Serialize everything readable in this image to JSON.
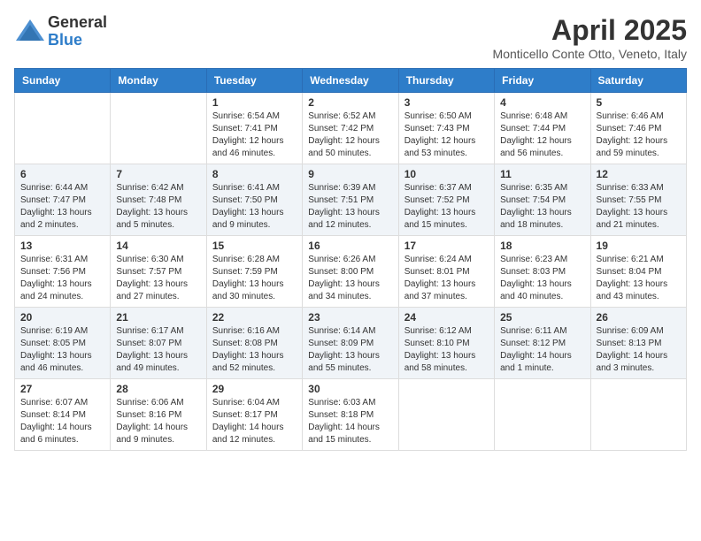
{
  "header": {
    "logo_general": "General",
    "logo_blue": "Blue",
    "month": "April 2025",
    "location": "Monticello Conte Otto, Veneto, Italy"
  },
  "weekdays": [
    "Sunday",
    "Monday",
    "Tuesday",
    "Wednesday",
    "Thursday",
    "Friday",
    "Saturday"
  ],
  "weeks": [
    [
      {
        "day": "",
        "info": ""
      },
      {
        "day": "",
        "info": ""
      },
      {
        "day": "1",
        "info": "Sunrise: 6:54 AM\nSunset: 7:41 PM\nDaylight: 12 hours and 46 minutes."
      },
      {
        "day": "2",
        "info": "Sunrise: 6:52 AM\nSunset: 7:42 PM\nDaylight: 12 hours and 50 minutes."
      },
      {
        "day": "3",
        "info": "Sunrise: 6:50 AM\nSunset: 7:43 PM\nDaylight: 12 hours and 53 minutes."
      },
      {
        "day": "4",
        "info": "Sunrise: 6:48 AM\nSunset: 7:44 PM\nDaylight: 12 hours and 56 minutes."
      },
      {
        "day": "5",
        "info": "Sunrise: 6:46 AM\nSunset: 7:46 PM\nDaylight: 12 hours and 59 minutes."
      }
    ],
    [
      {
        "day": "6",
        "info": "Sunrise: 6:44 AM\nSunset: 7:47 PM\nDaylight: 13 hours and 2 minutes."
      },
      {
        "day": "7",
        "info": "Sunrise: 6:42 AM\nSunset: 7:48 PM\nDaylight: 13 hours and 5 minutes."
      },
      {
        "day": "8",
        "info": "Sunrise: 6:41 AM\nSunset: 7:50 PM\nDaylight: 13 hours and 9 minutes."
      },
      {
        "day": "9",
        "info": "Sunrise: 6:39 AM\nSunset: 7:51 PM\nDaylight: 13 hours and 12 minutes."
      },
      {
        "day": "10",
        "info": "Sunrise: 6:37 AM\nSunset: 7:52 PM\nDaylight: 13 hours and 15 minutes."
      },
      {
        "day": "11",
        "info": "Sunrise: 6:35 AM\nSunset: 7:54 PM\nDaylight: 13 hours and 18 minutes."
      },
      {
        "day": "12",
        "info": "Sunrise: 6:33 AM\nSunset: 7:55 PM\nDaylight: 13 hours and 21 minutes."
      }
    ],
    [
      {
        "day": "13",
        "info": "Sunrise: 6:31 AM\nSunset: 7:56 PM\nDaylight: 13 hours and 24 minutes."
      },
      {
        "day": "14",
        "info": "Sunrise: 6:30 AM\nSunset: 7:57 PM\nDaylight: 13 hours and 27 minutes."
      },
      {
        "day": "15",
        "info": "Sunrise: 6:28 AM\nSunset: 7:59 PM\nDaylight: 13 hours and 30 minutes."
      },
      {
        "day": "16",
        "info": "Sunrise: 6:26 AM\nSunset: 8:00 PM\nDaylight: 13 hours and 34 minutes."
      },
      {
        "day": "17",
        "info": "Sunrise: 6:24 AM\nSunset: 8:01 PM\nDaylight: 13 hours and 37 minutes."
      },
      {
        "day": "18",
        "info": "Sunrise: 6:23 AM\nSunset: 8:03 PM\nDaylight: 13 hours and 40 minutes."
      },
      {
        "day": "19",
        "info": "Sunrise: 6:21 AM\nSunset: 8:04 PM\nDaylight: 13 hours and 43 minutes."
      }
    ],
    [
      {
        "day": "20",
        "info": "Sunrise: 6:19 AM\nSunset: 8:05 PM\nDaylight: 13 hours and 46 minutes."
      },
      {
        "day": "21",
        "info": "Sunrise: 6:17 AM\nSunset: 8:07 PM\nDaylight: 13 hours and 49 minutes."
      },
      {
        "day": "22",
        "info": "Sunrise: 6:16 AM\nSunset: 8:08 PM\nDaylight: 13 hours and 52 minutes."
      },
      {
        "day": "23",
        "info": "Sunrise: 6:14 AM\nSunset: 8:09 PM\nDaylight: 13 hours and 55 minutes."
      },
      {
        "day": "24",
        "info": "Sunrise: 6:12 AM\nSunset: 8:10 PM\nDaylight: 13 hours and 58 minutes."
      },
      {
        "day": "25",
        "info": "Sunrise: 6:11 AM\nSunset: 8:12 PM\nDaylight: 14 hours and 1 minute."
      },
      {
        "day": "26",
        "info": "Sunrise: 6:09 AM\nSunset: 8:13 PM\nDaylight: 14 hours and 3 minutes."
      }
    ],
    [
      {
        "day": "27",
        "info": "Sunrise: 6:07 AM\nSunset: 8:14 PM\nDaylight: 14 hours and 6 minutes."
      },
      {
        "day": "28",
        "info": "Sunrise: 6:06 AM\nSunset: 8:16 PM\nDaylight: 14 hours and 9 minutes."
      },
      {
        "day": "29",
        "info": "Sunrise: 6:04 AM\nSunset: 8:17 PM\nDaylight: 14 hours and 12 minutes."
      },
      {
        "day": "30",
        "info": "Sunrise: 6:03 AM\nSunset: 8:18 PM\nDaylight: 14 hours and 15 minutes."
      },
      {
        "day": "",
        "info": ""
      },
      {
        "day": "",
        "info": ""
      },
      {
        "day": "",
        "info": ""
      }
    ]
  ]
}
